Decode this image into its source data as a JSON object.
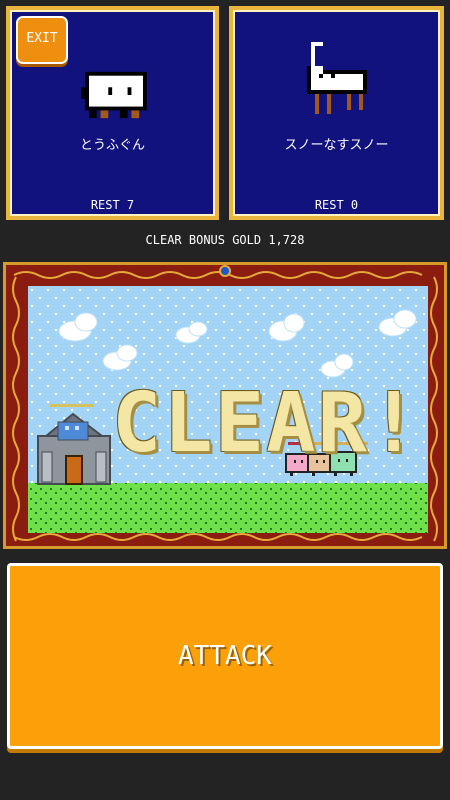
{
  "header": {
    "exit_label": "EXIT"
  },
  "cards": [
    {
      "name": "とうふぐん",
      "rest": "REST 7",
      "icon": "tofu-sheep-icon"
    },
    {
      "name": "スノーなすスノー",
      "rest": "REST 0",
      "icon": "snow-sheep-icon"
    }
  ],
  "bonus_text": "CLEAR BONUS GOLD 1,728",
  "battle": {
    "result_text": "CLEAR!"
  },
  "attack_label": "ATTACK",
  "colors": {
    "card_bg": "#12127f",
    "card_border": "#e9b53c",
    "exit_button": "#ef8f10",
    "attack_button": "#fba009",
    "frame": "#8a1d10",
    "sky": "#a3d4f5",
    "grass": "#6fe04a",
    "clear_text": "#f4e7a6"
  }
}
